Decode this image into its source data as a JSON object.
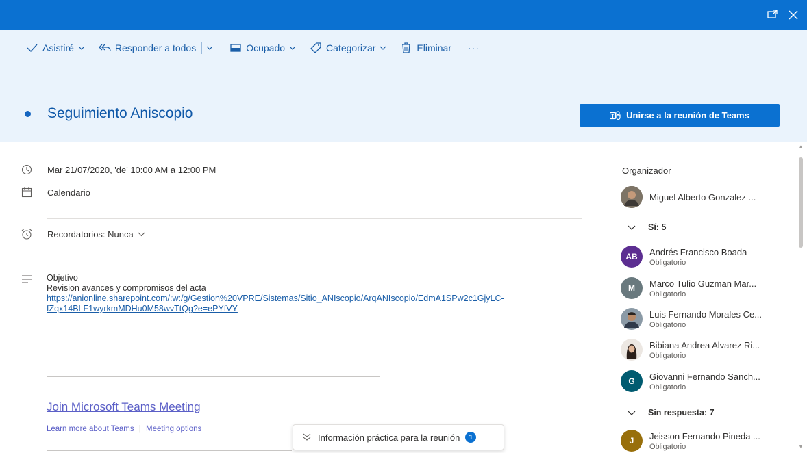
{
  "window": {
    "popout_icon": "popout-icon",
    "close_icon": "close-icon"
  },
  "toolbar": {
    "attended_label": "Asistiré",
    "reply_all_label": "Responder a todos",
    "busy_label": "Ocupado",
    "categorize_label": "Categorizar",
    "delete_label": "Eliminar",
    "more_label": "···"
  },
  "event": {
    "title": "Seguimiento Aniscopio",
    "join_teams_label": "Unirse a la reunión de Teams",
    "datetime": "Mar 21/07/2020, 'de' 10:00 AM a 12:00 PM",
    "calendar": "Calendario",
    "reminders": "Recordatorios: Nunca"
  },
  "body": {
    "heading": "Objetivo",
    "line1": "Revision avances y compromisos del acta",
    "link_line1": "https://anionline.sharepoint.com/:w:/g/Gestion%20VPRE/Sistemas/Sitio_ANIscopio/ArqANIscopio/EdmA1SPw2c1GjyLC-",
    "link_line2": "fZqx14BLF1wyrkmMDHu0M58wvTtQg?e=ePYfVY",
    "join_meeting": "Join Microsoft Teams Meeting",
    "learn_more": "Learn more about Teams",
    "separator": "|",
    "meeting_options": "Meeting options"
  },
  "info_pill": {
    "label": "Información práctica para la reunión",
    "badge": "1"
  },
  "attendees": {
    "organizer_heading": "Organizador",
    "organizer_name": "Miguel Alberto Gonzalez ...",
    "yes_group": "Sí: 5",
    "no_response_group": "Sin respuesta: 7",
    "people": [
      {
        "initials": "AB",
        "name": "Andrés Francisco Boada",
        "role": "Obligatorio",
        "color": "#5c2e91"
      },
      {
        "initials": "M",
        "name": "Marco Tulio Guzman Mar...",
        "role": "Obligatorio",
        "color": "#69797e"
      },
      {
        "initials": "",
        "name": "Luis Fernando Morales Ce...",
        "role": "Obligatorio",
        "color": "#7a6a58"
      },
      {
        "initials": "",
        "name": "Bibiana Andrea Alvarez Ri...",
        "role": "Obligatorio",
        "color": "#d9cfc6"
      },
      {
        "initials": "G",
        "name": "Giovanni Fernando Sanch...",
        "role": "Obligatorio",
        "color": "#005b70"
      },
      {
        "initials": "J",
        "name": "Jeisson Fernando Pineda ...",
        "role": "Obligatorio",
        "color": "#986f0b"
      }
    ]
  },
  "colors": {
    "accent": "#0b71d1",
    "header_bg": "#eaf3fc",
    "link": "#1a5ea8",
    "teams_purple": "#5b5fc7"
  }
}
